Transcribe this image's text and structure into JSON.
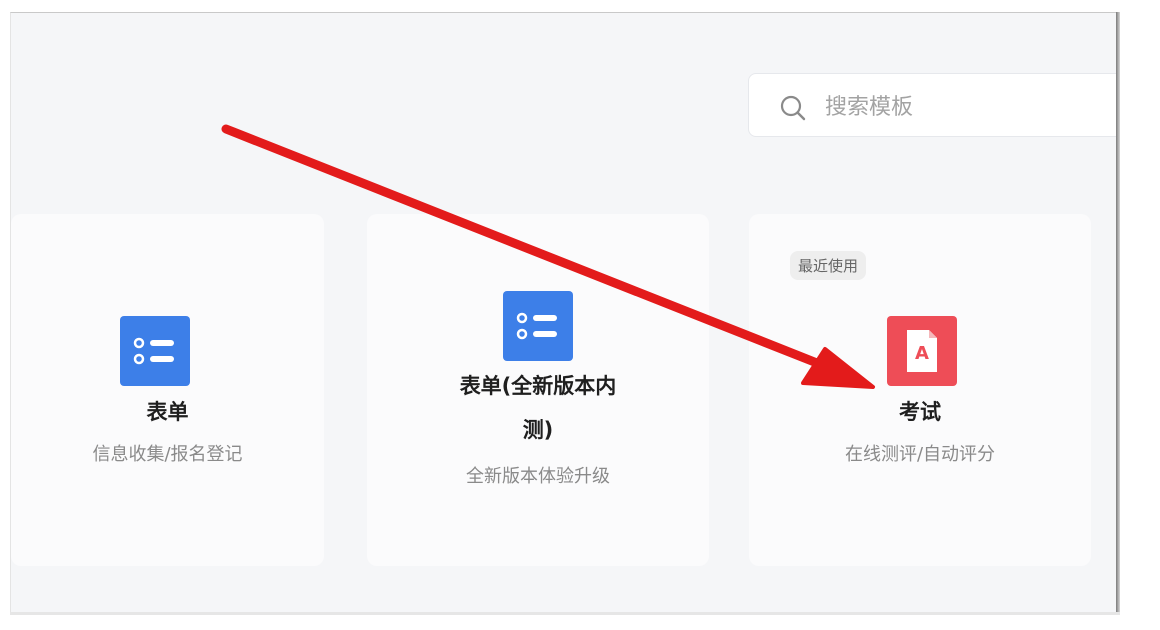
{
  "search": {
    "placeholder": "搜索模板",
    "icon": "search-icon"
  },
  "templates": [
    {
      "title": "表单",
      "description": "信息收集/报名登记",
      "icon": "list-form-icon",
      "icon_color": "#3d7fe8"
    },
    {
      "title": "表单(全新版本内测)",
      "title_lines": [
        "表单(全新版本内",
        "测)"
      ],
      "description": "全新版本体验升级",
      "icon": "list-form-icon",
      "icon_color": "#3d7fe8"
    },
    {
      "title": "考试",
      "description": "在线测评/自动评分",
      "badge": "最近使用",
      "icon": "exam-paper-icon",
      "icon_color": "#ee4d57"
    }
  ],
  "annotation": {
    "arrow_color": "#e31b1b"
  }
}
